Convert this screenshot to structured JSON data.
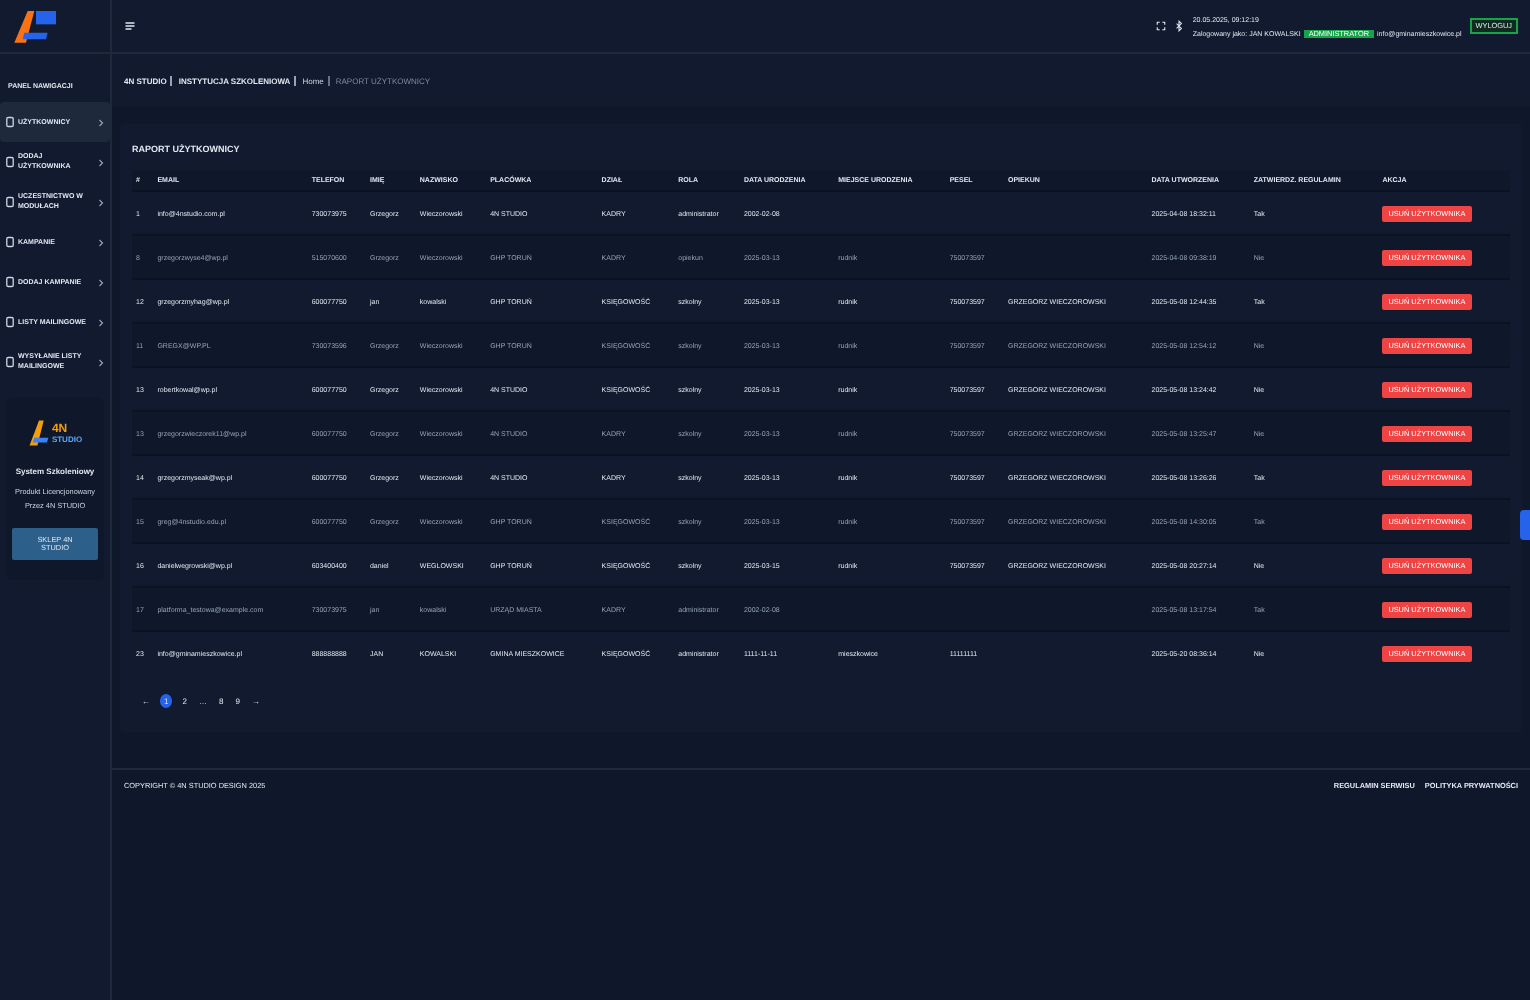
{
  "topbar": {
    "datetime": "20.05.2025, 09:12:19",
    "logged_as": "Zalogowany jako: JAN KOWALSKI",
    "role_badge": "ADMINISTRATOR",
    "email": "info@gminamieszkowice.pl",
    "logout": "WYLOGUJ"
  },
  "sidebar": {
    "heading": "PANEL NAWIGACJI",
    "items": [
      {
        "label": "UŻYTKOWNICY",
        "selected": true
      },
      {
        "label": "DODAJ UŻYTKOWNIKA",
        "selected": false
      },
      {
        "label": "UCZESTNICTWO W MODUŁACH",
        "selected": false
      },
      {
        "label": "KAMPANIE",
        "selected": false
      },
      {
        "label": "DODAJ KAMPANIE",
        "selected": false
      },
      {
        "label": "LISTY MAILINGOWE",
        "selected": false
      },
      {
        "label": "WYSYŁANIE LISTY MAILINGOWE",
        "selected": false
      }
    ],
    "promo": {
      "logo_top": "4N",
      "logo_bottom": "STUDIO",
      "title": "System Szkoleniowy",
      "line_1": "Produkt Licencjonowany",
      "line_2": "Przez 4N STUDIO",
      "button": "SKLEP 4N STUDIO"
    }
  },
  "breadcrumb": {
    "brand": "4N STUDIO",
    "org": "INSTYTUCJA SZKOLENIOWA",
    "home": "Home",
    "current": "RAPORT UŻYTKOWNICY"
  },
  "report": {
    "title": "RAPORT UŻYTKOWNICY",
    "columns": [
      "#",
      "EMAIL",
      "TELEFON",
      "IMIĘ",
      "NAZWISKO",
      "PLACÓWKA",
      "DZIAŁ",
      "ROLA",
      "DATA URODZENIA",
      "MIEJSCE URODZENIA",
      "PESEL",
      "OPIEKUN",
      "DATA UTWORZENIA",
      "ZATWIERDZ. REGULAMIN",
      "AKCJA"
    ],
    "rows": [
      {
        "cells": [
          "1",
          "info@4nstudio.com.pl",
          "730073975",
          "Grzegorz",
          "Wieczorowski",
          "4N STUDIO",
          "KADRY",
          "administrator",
          "2002-02-08",
          "",
          "",
          "",
          "2025-04-08 18:32:11",
          "Tak"
        ],
        "action": "USUŃ UŻYTKOWNIKA"
      },
      {
        "cells": [
          "8",
          "grzegorzwyse4@wp.pl",
          "515070600",
          "Grzegorz",
          "Wieczorowski",
          "GHP TORUŃ",
          "KADRY",
          "opiekun",
          "2025-03-13",
          "rudnik",
          "750073597",
          "",
          "2025-04-08 09:38:19",
          "Nie"
        ],
        "action": "USUŃ UŻYTKOWNIKA"
      },
      {
        "cells": [
          "12",
          "grzegorzmyhag@wp.pl",
          "600077750",
          "jan",
          "kowalski",
          "GHP TORUŃ",
          "KSIĘGOWOŚĆ",
          "szkolny",
          "2025-03-13",
          "rudnik",
          "750073597",
          "GRZEGORZ WIECZOROWSKI",
          "2025-05-08 12:44:35",
          "Tak"
        ],
        "action": "USUŃ UŻYTKOWNIKA"
      },
      {
        "cells": [
          "11",
          "GREGX@WP.PL",
          "730073596",
          "Grzegorz",
          "Wieczorowski",
          "GHP TORUŃ",
          "KSIĘGOWOŚĆ",
          "szkolny",
          "2025-03-13",
          "rudnik",
          "750073597",
          "GRZEGORZ WIECZOROWSKI",
          "2025-05-08 12:54:12",
          "Nie"
        ],
        "action": "USUŃ UŻYTKOWNIKA"
      },
      {
        "cells": [
          "13",
          "robertkowal@wp.pl",
          "600077750",
          "Grzegorz",
          "Wieczorowski",
          "4N STUDIO",
          "KSIĘGOWOŚĆ",
          "szkolny",
          "2025-03-13",
          "rudnik",
          "750073597",
          "GRZEGORZ WIECZOROWSKI",
          "2025-05-08 13:24:42",
          "Nie"
        ],
        "action": "USUŃ UŻYTKOWNIKA"
      },
      {
        "cells": [
          "13",
          "grzegorzwieczorek11@wp.pl",
          "600077750",
          "Grzegorz",
          "Wieczorowski",
          "4N STUDIO",
          "KADRY",
          "szkolny",
          "2025-03-13",
          "rudnik",
          "750073597",
          "GRZEGORZ WIECZOROWSKI",
          "2025-05-08 13:25:47",
          "Nie"
        ],
        "action": "USUŃ UŻYTKOWNIKA"
      },
      {
        "cells": [
          "14",
          "grzegorzmyseak@wp.pl",
          "600077750",
          "Grzegorz",
          "Wieczorowski",
          "4N STUDIO",
          "KADRY",
          "szkolny",
          "2025-03-13",
          "rudnik",
          "750073597",
          "GRZEGORZ WIECZOROWSKI",
          "2025-05-08 13:26:26",
          "Tak"
        ],
        "action": "USUŃ UŻYTKOWNIKA"
      },
      {
        "cells": [
          "15",
          "greg@4nstudio.edu.pl",
          "600077750",
          "Grzegorz",
          "Wieczorowski",
          "GHP TORUŃ",
          "KSIĘGOWOŚĆ",
          "szkolny",
          "2025-03-13",
          "rudnik",
          "750073597",
          "GRZEGORZ WIECZOROWSKI",
          "2025-05-08 14:30:05",
          "Tak"
        ],
        "action": "USUŃ UŻYTKOWNIKA"
      },
      {
        "cells": [
          "16",
          "danielwegrowski@wp.pl",
          "603400400",
          "daniel",
          "WEGLOWSKI",
          "GHP TORUŃ",
          "KSIĘGOWOŚĆ",
          "szkolny",
          "2025-03-15",
          "rudnik",
          "750073597",
          "GRZEGORZ WIECZOROWSKI",
          "2025-05-08 20:27:14",
          "Nie"
        ],
        "action": "USUŃ UŻYTKOWNIKA"
      },
      {
        "cells": [
          "17",
          "platforma_testowa@example.com",
          "730073975",
          "jan",
          "kowalski",
          "URZĄD MIASTA",
          "KADRY",
          "administrator",
          "2002-02-08",
          "",
          "",
          "",
          "2025-05-08 13:17:54",
          "Tak"
        ],
        "action": "USUŃ UŻYTKOWNIKA"
      },
      {
        "cells": [
          "23",
          "info@gminamieszkowice.pl",
          "888888888",
          "JAN",
          "KOWALSKI",
          "GMINA MIESZKOWICE",
          "KSIĘGOWOŚĆ",
          "administrator",
          "1111-11-11",
          "mieszkowice",
          "11111111",
          "",
          "2025-05-20 08:36:14",
          "Nie"
        ],
        "action": "USUŃ UŻYTKOWNIKA"
      }
    ],
    "pagination": [
      {
        "label": "←",
        "selected": false
      },
      {
        "label": "1",
        "selected": true
      },
      {
        "label": "2",
        "selected": false
      },
      {
        "label": "…",
        "selected": false
      },
      {
        "label": "8",
        "selected": false
      },
      {
        "label": "9",
        "selected": false
      },
      {
        "label": "→",
        "selected": false
      }
    ]
  },
  "footer": {
    "copyright": "COPYRIGHT © 4N STUDIO DESIGN 2025",
    "links": [
      "REGULAMIN SERWISU",
      "POLITYKA PRYWATNOŚCI"
    ]
  }
}
